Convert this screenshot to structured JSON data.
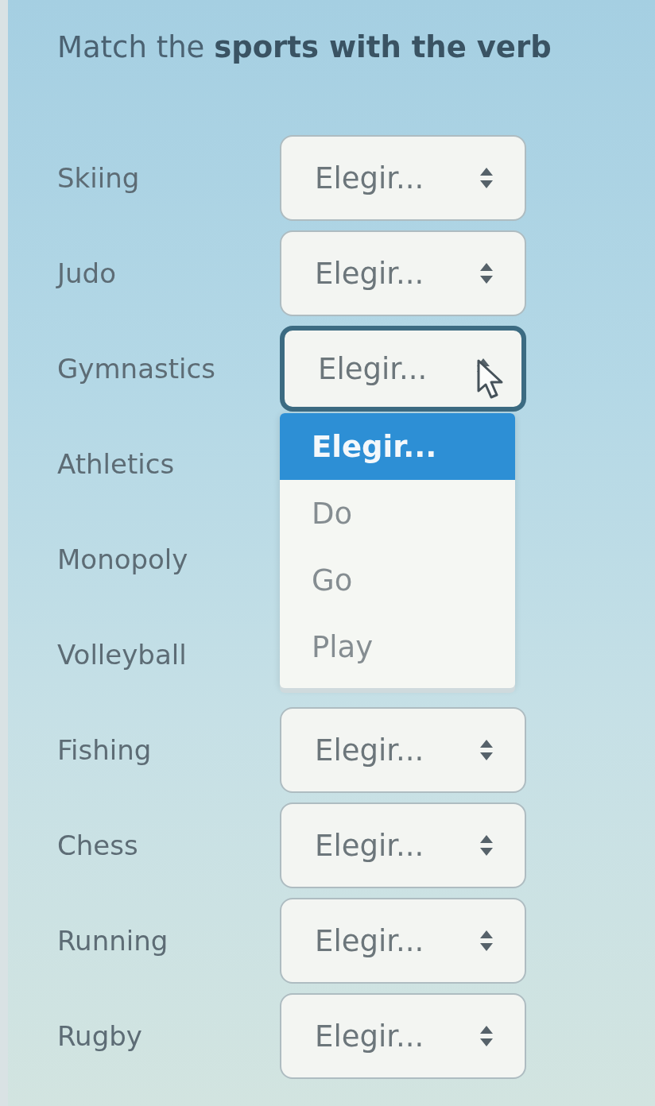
{
  "instruction": "Match the **sports with the verb**",
  "rows": [
    {
      "label": "Skiing",
      "value": "Elegir...",
      "focused": false
    },
    {
      "label": "Judo",
      "value": "Elegir...",
      "focused": false
    },
    {
      "label": "Gymnastics",
      "value": "Elegir...",
      "focused": true,
      "options": [
        {
          "label": "Elegir...",
          "selected": true
        },
        {
          "label": "Do",
          "selected": false
        },
        {
          "label": "Go",
          "selected": false
        },
        {
          "label": "Play",
          "selected": false
        }
      ]
    },
    {
      "label": "Athletics"
    },
    {
      "label": "Monopoly"
    },
    {
      "label": "Volleyball"
    },
    {
      "label": "Fishing",
      "value": "Elegir...",
      "focused": false
    },
    {
      "label": "Chess",
      "value": "Elegir...",
      "focused": false
    },
    {
      "label": "Running",
      "value": "Elegir...",
      "focused": false
    },
    {
      "label": "Rugby",
      "value": "Elegir...",
      "focused": false
    }
  ]
}
